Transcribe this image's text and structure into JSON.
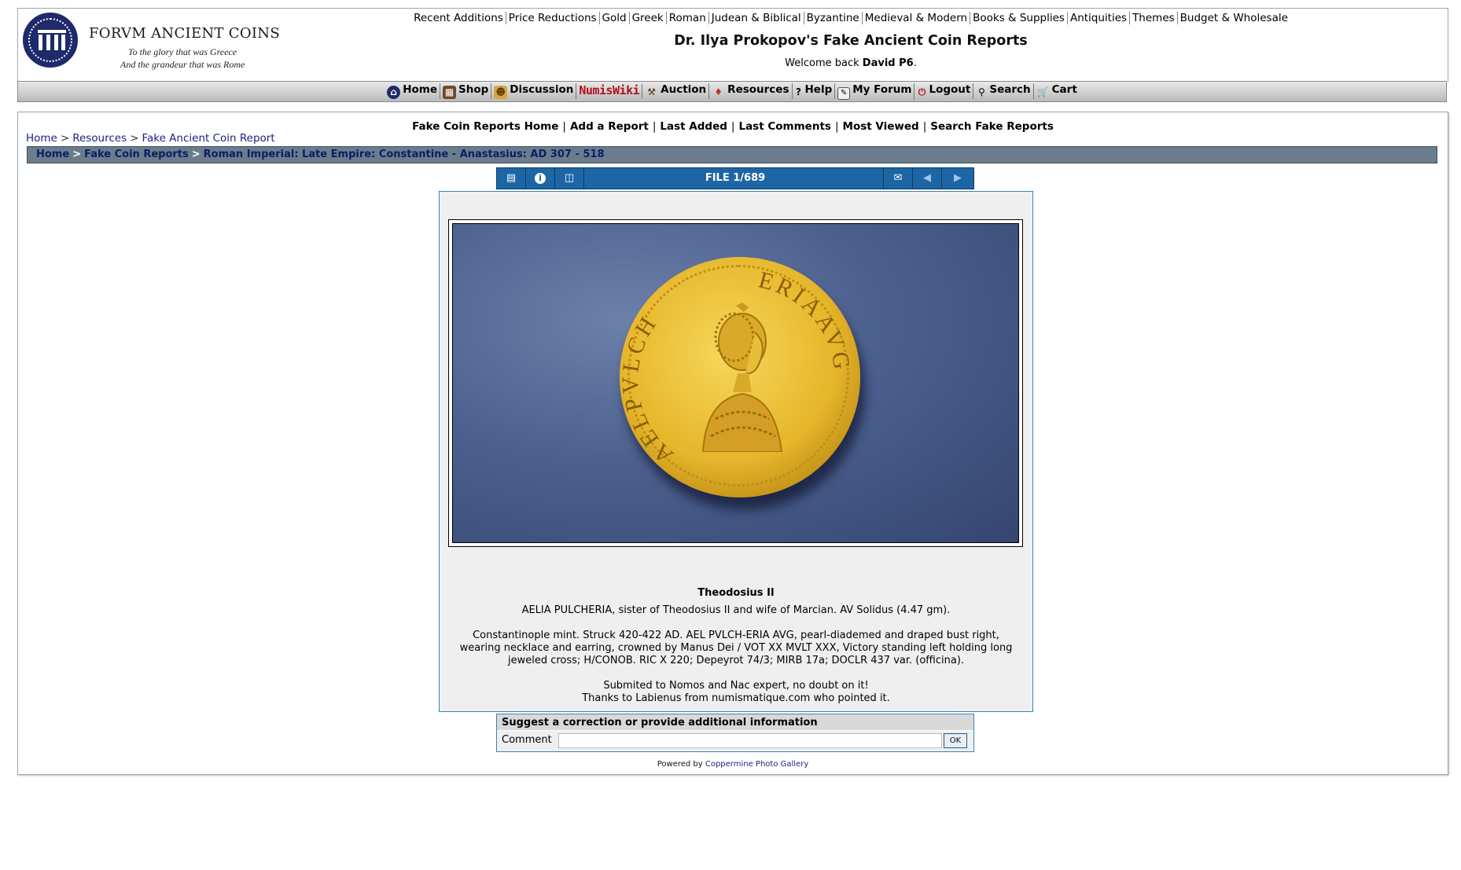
{
  "logo": {
    "title": "FORVM ANCIENT COINS",
    "tagline1": "To the glory that was Greece",
    "tagline2": "And the grandeur that was Rome"
  },
  "topnav": [
    "Recent Additions",
    "Price Reductions",
    "Gold",
    "Greek",
    "Roman",
    "Judean & Biblical",
    "Byzantine",
    "Medieval & Modern",
    "Books & Supplies",
    "Antiquities",
    "Themes",
    "Budget & Wholesale"
  ],
  "site_title": "Dr. Ilya Prokopov's Fake Ancient Coin Reports",
  "welcome": {
    "prefix": "Welcome back ",
    "user": "David P6",
    "suffix": "."
  },
  "mainnav": {
    "home": "Home",
    "shop": "Shop",
    "discussion": "Discussion",
    "numiswiki": "NumisWiki",
    "auction": "Auction",
    "resources": "Resources",
    "help": "Help",
    "my_forum": "My Forum",
    "logout": "Logout",
    "search": "Search",
    "cart": "Cart"
  },
  "subnav": [
    "Fake Coin Reports Home",
    "Add a Report",
    "Last Added",
    "Last Comments",
    "Most Viewed",
    "Search Fake Reports"
  ],
  "crumb_outer": [
    "Home",
    "Resources",
    "Fake Ancient Coin Report"
  ],
  "crumb_bar": [
    "Home",
    "Fake Coin Reports",
    "Roman Imperial: Late Empire: Constantine - Anastasius: AD 307 - 518"
  ],
  "toolbar": {
    "file_counter": "FILE 1/689"
  },
  "coin": {
    "legend_left": "AELPVLCH",
    "legend_right": "ERIAAVG",
    "title": "Theodosius II",
    "desc1": "AELIA PULCHERIA, sister of Theodosius II and wife of Marcian. AV Solidus (4.47 gm).",
    "desc2": "Constantinople mint. Struck 420-422 AD. AEL PVLCH-ERIA AVG, pearl-diademed and draped bust right, wearing necklace and earring, crowned by Manus Dei / VOT XX MVLT XXX, Victory standing left holding long jeweled cross; H/CONOB. RIC X 220; Depeyrot 74/3; MIRB 17a; DOCLR 437 var. (officina).",
    "note1": "Submited to Nomos and Nac expert, no doubt on it!",
    "note2": "Thanks to Labienus from numismatique.com who pointed it."
  },
  "comment_form": {
    "heading": "Suggest a correction or provide additional information",
    "label": "Comment",
    "value": "",
    "ok_label": "OK"
  },
  "footer": {
    "prefix": "Powered by ",
    "link": "Coppermine Photo Gallery"
  }
}
